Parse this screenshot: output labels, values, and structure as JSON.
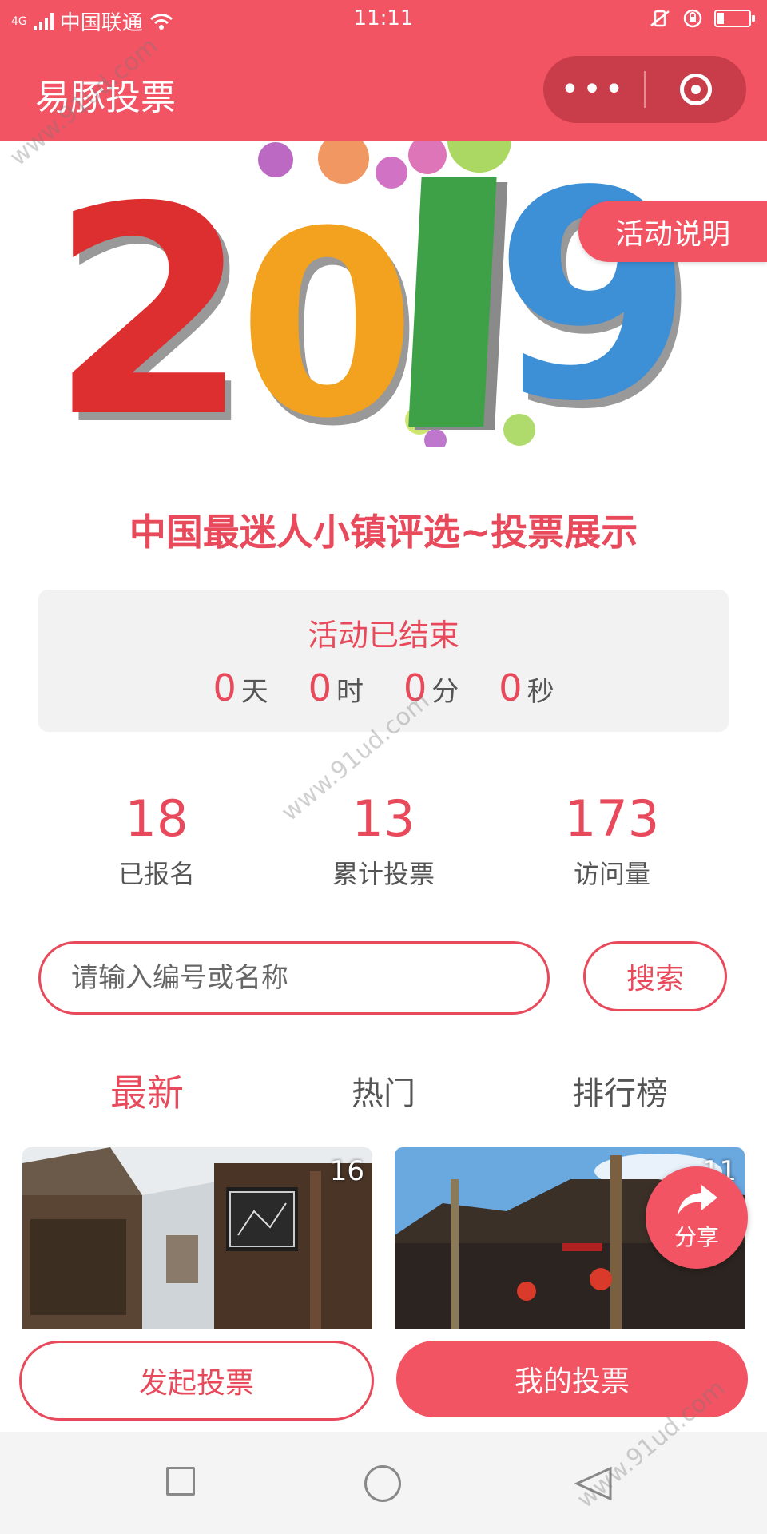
{
  "status_bar": {
    "network": "4G",
    "carrier": "中国联通",
    "time": "11:11"
  },
  "header": {
    "title": "易豚投票",
    "more_label": "•••"
  },
  "banner": {
    "year_text": "2019",
    "rules_button": "活动说明"
  },
  "event": {
    "title": "中国最迷人小镇评选~投票展示"
  },
  "countdown": {
    "status": "活动已结束",
    "units": [
      {
        "value": "0",
        "label": "天"
      },
      {
        "value": "0",
        "label": "时"
      },
      {
        "value": "0",
        "label": "分"
      },
      {
        "value": "0",
        "label": "秒"
      }
    ]
  },
  "stats": [
    {
      "value": "18",
      "label": "已报名"
    },
    {
      "value": "13",
      "label": "累计投票"
    },
    {
      "value": "173",
      "label": "访问量"
    }
  ],
  "search": {
    "placeholder": "请输入编号或名称",
    "button": "搜索"
  },
  "tabs": [
    {
      "label": "最新",
      "active": true
    },
    {
      "label": "热门",
      "active": false
    },
    {
      "label": "排行榜",
      "active": false
    }
  ],
  "cards": [
    {
      "number": "16"
    },
    {
      "number": "11"
    }
  ],
  "share": {
    "label": "分享"
  },
  "actions": {
    "start_vote": "发起投票",
    "my_vote": "我的投票"
  },
  "watermark": "www.91ud.com",
  "colors": {
    "primary": "#f25463",
    "accent_text": "#e8495b"
  }
}
